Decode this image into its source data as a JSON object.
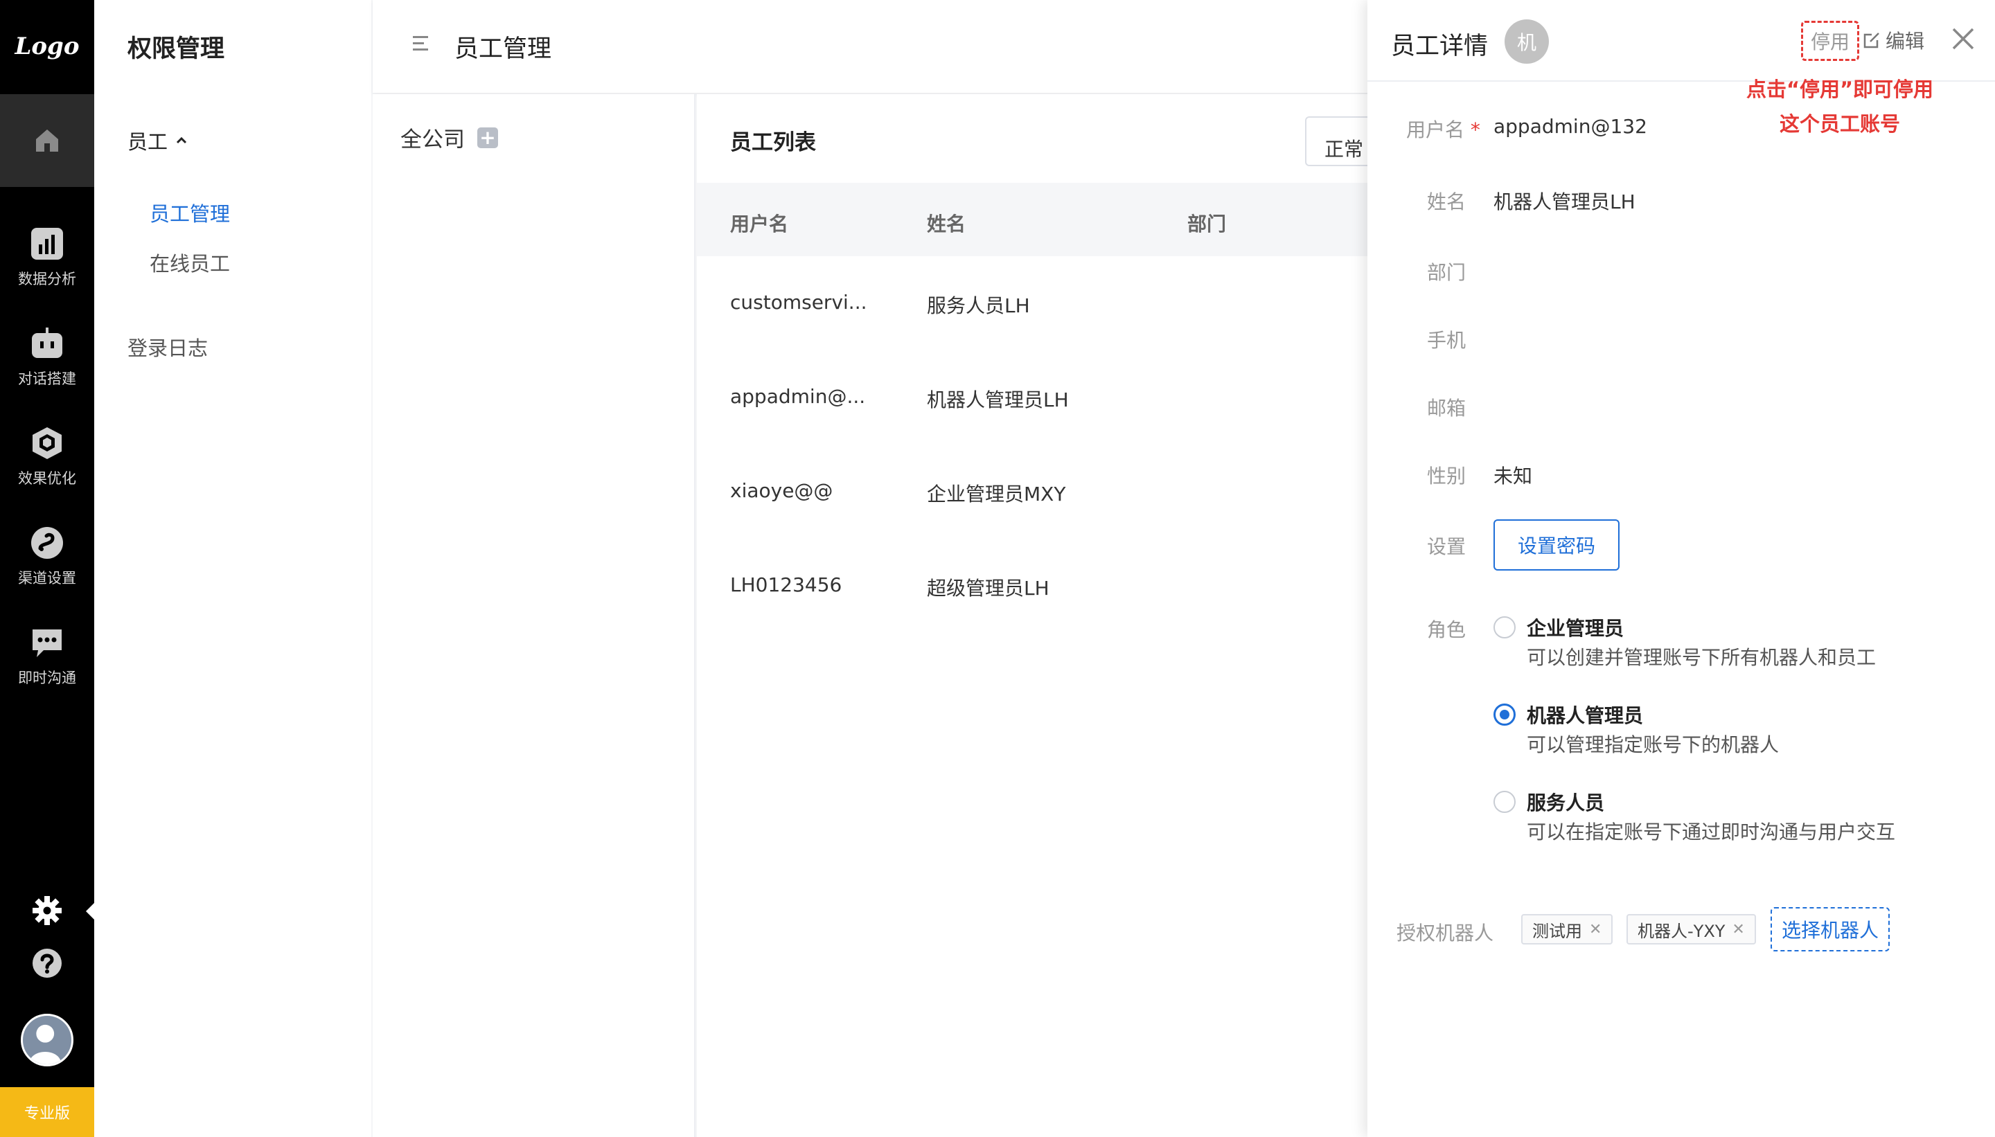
{
  "rail": {
    "logo": "Logo",
    "items": [
      {
        "label": "数据分析",
        "icon": "bar-chart-icon"
      },
      {
        "label": "对话搭建",
        "icon": "robot-icon"
      },
      {
        "label": "效果优化",
        "icon": "cube-icon"
      },
      {
        "label": "渠道设置",
        "icon": "channel-icon"
      },
      {
        "label": "即时沟通",
        "icon": "chat-icon"
      }
    ],
    "edition": "专业版"
  },
  "menu": {
    "title": "权限管理",
    "group_label": "员工",
    "sub_items": [
      "员工管理",
      "在线员工"
    ],
    "log_label": "登录日志"
  },
  "header": {
    "title": "员工管理"
  },
  "tree": {
    "root_label": "全公司"
  },
  "list": {
    "title": "员工列表",
    "status_filter": "正常",
    "columns": [
      "用户名",
      "姓名",
      "部门"
    ],
    "rows": [
      {
        "username": "customservi...",
        "name": "服务人员LH",
        "dept": ""
      },
      {
        "username": "appadmin@...",
        "name": "机器人管理员LH",
        "dept": ""
      },
      {
        "username": "xiaoye@@",
        "name": "企业管理员MXY",
        "dept": ""
      },
      {
        "username": "LH0123456",
        "name": "超级管理员LH",
        "dept": ""
      }
    ]
  },
  "drawer": {
    "title": "员工详情",
    "avatar_char": "机",
    "disable_label": "停用",
    "edit_label": "编辑",
    "annotation_line1": "点击“停用”即可停用",
    "annotation_line2": "这个员工账号",
    "fields": {
      "username_label": "用户名",
      "username_required": "*",
      "username_value": "appadmin@132",
      "name_label": "姓名",
      "name_value": "机器人管理员LH",
      "dept_label": "部门",
      "phone_label": "手机",
      "email_label": "邮箱",
      "gender_label": "性别",
      "gender_value": "未知",
      "settings_label": "设置",
      "password_button": "设置密码",
      "role_label": "角色",
      "robots_label": "授权机器人"
    },
    "roles": [
      {
        "title": "企业管理员",
        "desc": "可以创建并管理账号下所有机器人和员工",
        "selected": false
      },
      {
        "title": "机器人管理员",
        "desc": "可以管理指定账号下的机器人",
        "selected": true
      },
      {
        "title": "服务人员",
        "desc": "可以在指定账号下通过即时沟通与用户交互",
        "selected": false
      }
    ],
    "robot_tags": [
      "测试用",
      "机器人-YXY"
    ],
    "choose_robot_button": "选择机器人"
  },
  "colors": {
    "accent": "#1f6fd8",
    "annotation": "#e53935",
    "rail_bg": "#000000",
    "edition_bg": "#f5b916"
  }
}
